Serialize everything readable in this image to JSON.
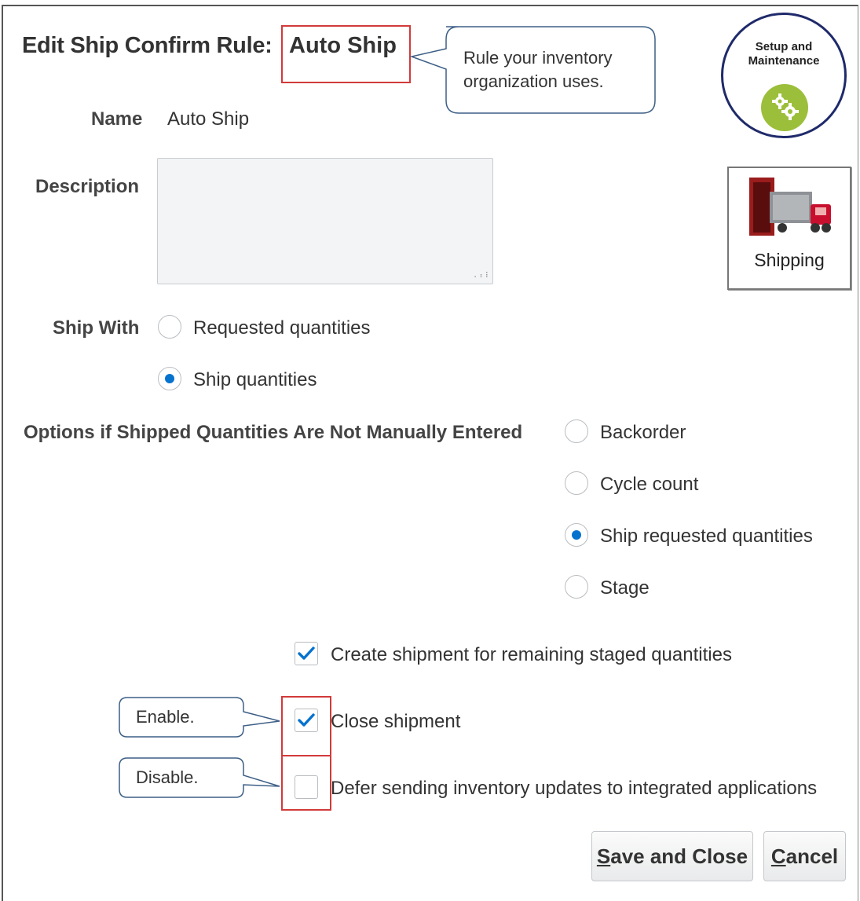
{
  "title": {
    "prefix": "Edit Ship Confirm Rule:",
    "value": "Auto Ship"
  },
  "callouts": {
    "rule": "Rule your inventory organization uses.",
    "enable": "Enable.",
    "disable": "Disable."
  },
  "badges": {
    "setup": "Setup and Maintenance",
    "shipping": "Shipping"
  },
  "form": {
    "name_label": "Name",
    "name_value": "Auto Ship",
    "description_label": "Description",
    "description_value": "",
    "ship_with_label": "Ship With",
    "ship_with_options": [
      {
        "label": "Requested quantities",
        "selected": false
      },
      {
        "label": "Ship quantities",
        "selected": true
      }
    ],
    "options_label": "Options if Shipped Quantities Are Not Manually Entered",
    "options": [
      {
        "label": "Backorder",
        "selected": false
      },
      {
        "label": "Cycle count",
        "selected": false
      },
      {
        "label": "Ship requested quantities",
        "selected": true
      },
      {
        "label": "Stage",
        "selected": false
      }
    ],
    "checkboxes": [
      {
        "label": "Create shipment for remaining staged quantities",
        "checked": true
      },
      {
        "label": "Close shipment",
        "checked": true
      },
      {
        "label": "Defer sending inventory updates to integrated applications",
        "checked": false
      }
    ]
  },
  "buttons": {
    "save_close_mnemonic": "S",
    "save_close_rest": "ave and Close",
    "cancel_mnemonic": "C",
    "cancel_rest": "ancel"
  },
  "colors": {
    "accent": "#0572ce",
    "highlight": "#d23a3a",
    "callout_border": "#3d5f86",
    "setup_green": "#9bbf3a",
    "truck_red": "#c8102e"
  },
  "icons": [
    "gear-icon",
    "truck-icon",
    "checkmark-icon"
  ]
}
